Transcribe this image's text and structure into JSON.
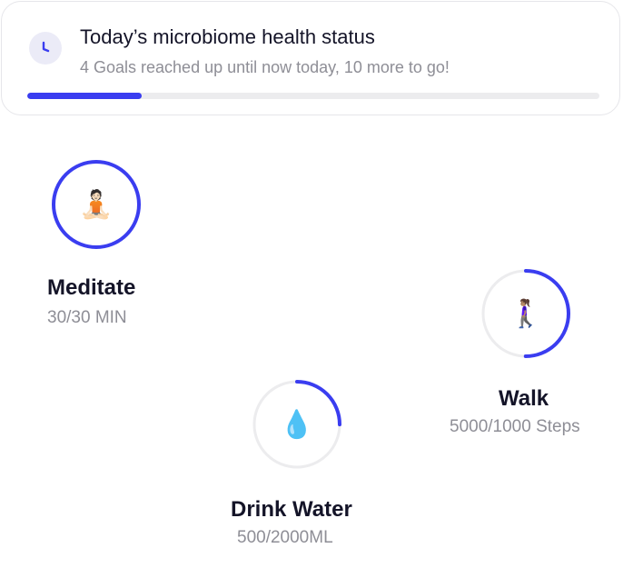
{
  "status": {
    "title": "Today’s microbiome health status",
    "subtitle": "4 Goals reached up until now today, 10 more to go!",
    "progress": 0.2,
    "icon": "clock-icon"
  },
  "colors": {
    "accent": "#3a3df0",
    "track": "#ececee",
    "text_primary": "#141428",
    "text_secondary": "#8e8e96"
  },
  "goals": [
    {
      "name": "Meditate",
      "value": "30/30 MIN",
      "progress": 1.0,
      "emoji": "🧘🏻",
      "icon": "meditation-icon"
    },
    {
      "name": "Walk",
      "value": "5000/1000 Steps",
      "progress": 0.5,
      "emoji": "🚶🏽‍♀️",
      "icon": "walking-person-icon"
    },
    {
      "name": "Drink Water",
      "value": "500/2000ML",
      "progress": 0.25,
      "emoji": "💧",
      "icon": "water-drop-icon"
    }
  ]
}
